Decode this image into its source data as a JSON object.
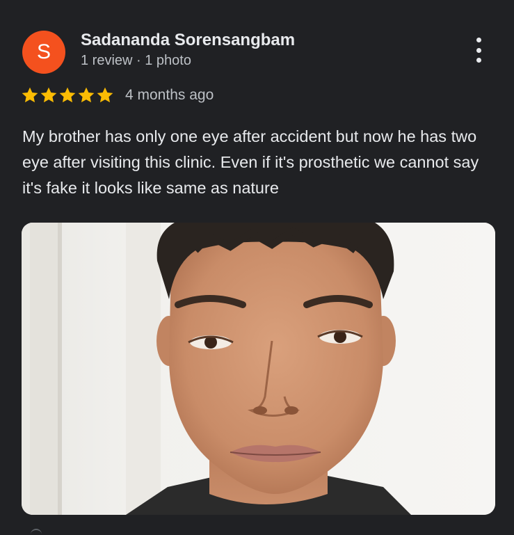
{
  "review": {
    "avatar_letter": "S",
    "avatar_color": "#f4511e",
    "author_name": "Sadananda Sorensangbam",
    "author_meta": "1 review · 1 photo",
    "rating": 5,
    "rating_max": 5,
    "star_color": "#fbbc04",
    "time": "4 months ago",
    "text": "My brother has only one eye after accident but now he has two eye after visiting this clinic. Even if it's prosthetic we cannot say it's fake it looks like same as nature",
    "more_icon": "more-vert-icon"
  },
  "theme": {
    "background": "#202124",
    "text_primary": "#e8eaed",
    "text_secondary": "#bdc1c6"
  }
}
